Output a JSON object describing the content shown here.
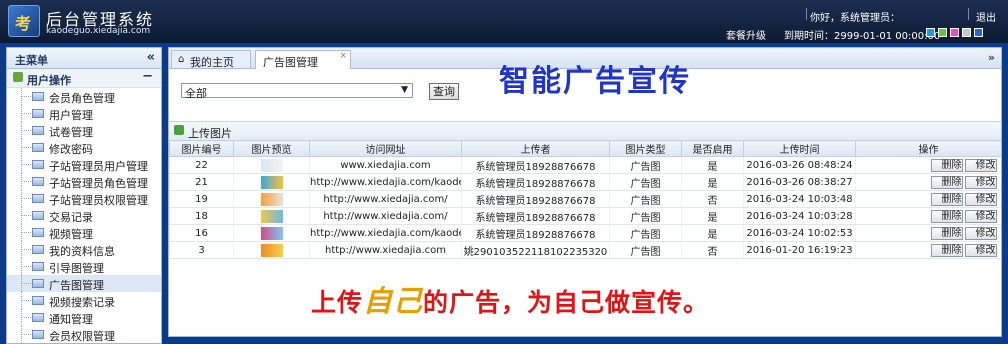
{
  "header": {
    "title": "后台管理系统",
    "url": "kaodeguo.xiedajia.com",
    "logo_char": "考",
    "greeting": "你好，系统管理员：",
    "logout": "退出",
    "upgrade": "套餐升级",
    "expire": "到期时间：2999-01-01 00:00:00",
    "theme_colors": [
      "#1e9be0",
      "#6bc13a",
      "#e84fb6",
      "#c7c7c7",
      "#2b63d4"
    ]
  },
  "sidebar": {
    "title": "主菜单",
    "group": "用户操作",
    "items": [
      "会员角色管理",
      "用户管理",
      "试卷管理",
      "修改密码",
      "子站管理员用户管理",
      "子站管理员角色管理",
      "子站管理员权限管理",
      "交易记录",
      "视频管理",
      "我的资料信息",
      "引导图管理",
      "广告图管理",
      "视频搜索记录",
      "通知管理",
      "会员权限管理"
    ],
    "active_index": 11
  },
  "tabs": {
    "home": "我的主页",
    "active": "广告图管理"
  },
  "filter": {
    "select_value": "全部",
    "query_button": "查询"
  },
  "promo": {
    "title": "智能广告宣传",
    "sub_a": "上传",
    "sub_hl": "自己",
    "sub_b": "的广告，为自己做宣传。"
  },
  "toolbar": {
    "upload": "上传图片"
  },
  "table": {
    "headers": [
      "图片编号",
      "图片预览",
      "访问网址",
      "上传者",
      "图片类型",
      "是否启用",
      "上传时间",
      "操作"
    ],
    "rows": [
      {
        "id": "22",
        "url": "www.xiedajia.com",
        "uploader": "系统管理员18928876678",
        "type": "广告图",
        "enabled": "是",
        "time": "2016-03-26 08:48:24",
        "thumb": [
          "#d8e6f2",
          "#f3f3f3"
        ]
      },
      {
        "id": "21",
        "url": "http://www.xiedajia.com/kaodeguo/",
        "uploader": "系统管理员18928876678",
        "type": "广告图",
        "enabled": "是",
        "time": "2016-03-26 08:38:27",
        "thumb": [
          "#3fa7e0",
          "#f4c23c"
        ]
      },
      {
        "id": "19",
        "url": "http://www.xiedajia.com/",
        "uploader": "系统管理员18928876678",
        "type": "广告图",
        "enabled": "否",
        "time": "2016-03-24 10:03:48",
        "thumb": [
          "#f2a13d",
          "#e9e3d8"
        ]
      },
      {
        "id": "18",
        "url": "http://www.xiedajia.com/",
        "uploader": "系统管理员18928876678",
        "type": "广告图",
        "enabled": "是",
        "time": "2016-03-24 10:03:28",
        "thumb": [
          "#f1c84a",
          "#6ab7e6"
        ]
      },
      {
        "id": "16",
        "url": "http://www.xiedajia.com/kaodeguo/",
        "uploader": "系统管理员18928876678",
        "type": "广告图",
        "enabled": "是",
        "time": "2016-03-24 10:02:53",
        "thumb": [
          "#d64a8a",
          "#7ec8ef"
        ]
      },
      {
        "id": "3",
        "url": "http://www.xiedajia.com",
        "uploader": "姚290103522118102235320",
        "type": "广告图",
        "enabled": "否",
        "time": "2016-01-20 16:19:23",
        "thumb": [
          "#ef8a2a",
          "#f6d24a"
        ]
      }
    ],
    "delete_label": "删除",
    "edit_label": "修改"
  }
}
